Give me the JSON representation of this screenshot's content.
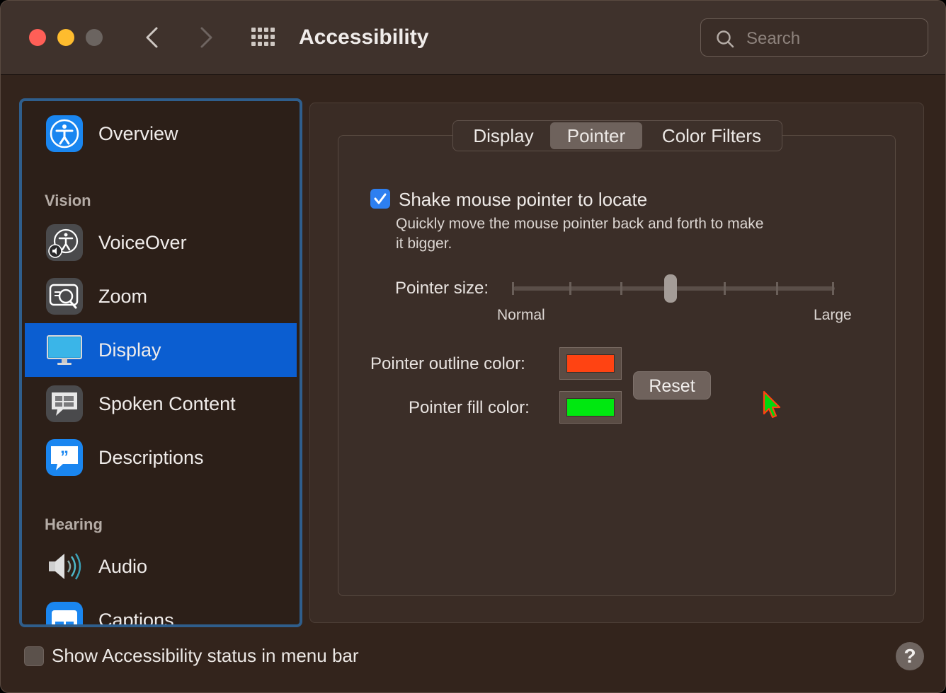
{
  "window": {
    "title": "Accessibility",
    "search": {
      "placeholder": "Search",
      "value": ""
    }
  },
  "sidebar": {
    "items": [
      {
        "label": "Overview",
        "icon": "accessibility-person-icon",
        "selected": false
      },
      {
        "label": "VoiceOver",
        "icon": "voiceover-icon",
        "selected": false
      },
      {
        "label": "Zoom",
        "icon": "zoom-icon",
        "selected": false
      },
      {
        "label": "Display",
        "icon": "display-monitor-icon",
        "selected": true
      },
      {
        "label": "Spoken Content",
        "icon": "speech-bubble-icon",
        "selected": false
      },
      {
        "label": "Descriptions",
        "icon": "quote-bubble-icon",
        "selected": false
      },
      {
        "label": "Audio",
        "icon": "speaker-icon",
        "selected": false
      },
      {
        "label": "Captions",
        "icon": "captions-icon",
        "selected": false
      }
    ],
    "sections": {
      "vision": "Vision",
      "hearing": "Hearing"
    }
  },
  "tabs": [
    {
      "label": "Display",
      "active": false
    },
    {
      "label": "Pointer",
      "active": true
    },
    {
      "label": "Color Filters",
      "active": false
    }
  ],
  "pointer": {
    "shake_label": "Shake mouse pointer to locate",
    "shake_checked": true,
    "shake_desc_line1": "Quickly move the mouse pointer back and forth to make",
    "shake_desc_line2": "it bigger.",
    "size_label": "Pointer size:",
    "size_min_label": "Normal",
    "size_max_label": "Large",
    "size_value": 0.49,
    "outline_label": "Pointer outline color:",
    "outline_color": "#ff4312",
    "fill_label": "Pointer fill color:",
    "fill_color": "#00e810",
    "reset_label": "Reset"
  },
  "footer": {
    "menu_bar_label": "Show Accessibility status in menu bar",
    "menu_bar_checked": false,
    "help_label": "?"
  },
  "colors": {
    "accent": "#0b5ed1",
    "checkbox_on": "#2d7ff0"
  }
}
